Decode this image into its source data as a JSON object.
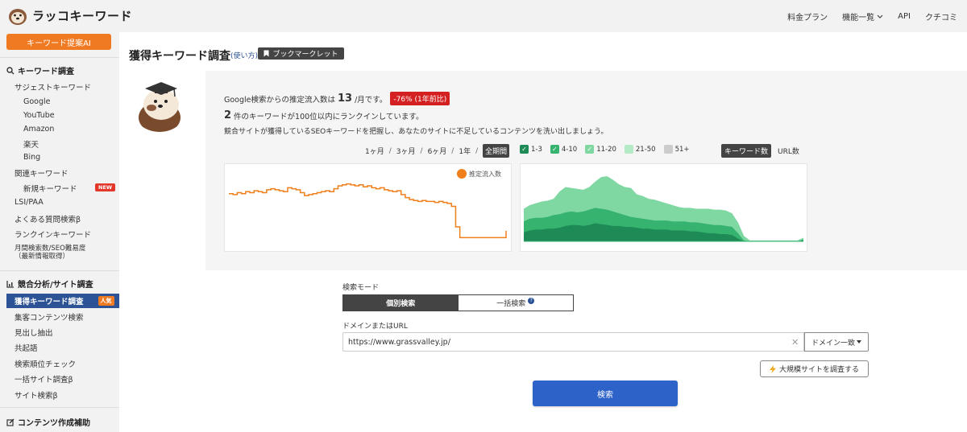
{
  "header": {
    "logo_text": "ラッコキーワード",
    "nav": [
      {
        "label": "料金プラン"
      },
      {
        "label": "機能一覧"
      },
      {
        "label": "API"
      },
      {
        "label": "クチコミ"
      }
    ]
  },
  "sidebar": {
    "ai_button": "キーワード提案AI",
    "section_keyword": "キーワード調査",
    "suggest": "サジェストキーワード",
    "sub_items": [
      "Google",
      "YouTube",
      "Amazon",
      "楽天",
      "Bing"
    ],
    "related": "関連キーワード",
    "new_keywords": "新規キーワード",
    "new_badge": "NEW",
    "lsi": "LSI/PAA",
    "faq": "よくある質問検索β",
    "rankin": "ランクインキーワード",
    "monthly_line1": "月間検索数/SEO難易度",
    "monthly_line2": "（最新情報取得）",
    "section_competitor": "競合分析/サイト調査",
    "acquired": "獲得キーワード調査",
    "popular_badge": "人気",
    "customer": "集客コンテンツ検索",
    "headings": "見出し抽出",
    "cooccur": "共起語",
    "rank_check": "検索順位チェック",
    "bulk_site": "一括サイト調査β",
    "site_search": "サイト検索β",
    "section_content": "コンテンツ作成補助"
  },
  "main": {
    "title": "獲得キーワード調査",
    "howto": "(使い方)",
    "bookmarklet": "ブックマークレット",
    "summary_prefix": "Google検索からの推定流入数は",
    "traffic_value": "13",
    "summary_suffix": "/月です。",
    "change_badge": "-76% (1年前比)",
    "rank_count": "2",
    "rank_text": "件のキーワードが100位以内にランクインしています。",
    "description": "競合サイトが獲得しているSEOキーワードを把握し、あなたのサイトに不足しているコンテンツを洗い出しましょう。",
    "periods": [
      "1ヶ月",
      "3ヶ月",
      "6ヶ月",
      "1年",
      "全期間"
    ],
    "selected_period": "全期間",
    "rank_filters": [
      {
        "label": "1-3",
        "color": "#1e8a55",
        "checked": true
      },
      {
        "label": "4-10",
        "color": "#35b36f",
        "checked": true
      },
      {
        "label": "11-20",
        "color": "#7fd8a2",
        "checked": true
      },
      {
        "label": "21-50",
        "color": "#b4eac6",
        "checked": false
      },
      {
        "label": "51+",
        "color": "#cccccc",
        "checked": false
      }
    ],
    "view_keyword": "キーワード数",
    "view_url": "URL数",
    "legend_traffic": "推定流入数"
  },
  "form": {
    "mode_label": "検索モード",
    "mode_single": "個別検索",
    "mode_bulk": "一括検索",
    "url_label": "ドメインまたはURL",
    "url_value": "https://www.grassvalley.jp/",
    "match_select": "ドメイン一致",
    "large_site": "大規模サイトを調査する",
    "search": "検索"
  },
  "colors": {
    "accent_orange": "#f07a22",
    "nav_active": "#2d5397",
    "search_button": "#2d62c9",
    "traffic_line": "#ef7f1a"
  },
  "chart_data": [
    {
      "type": "line",
      "series": [
        {
          "name": "推定流入数",
          "values": [
            48,
            47,
            49,
            48,
            50,
            49,
            51,
            50,
            49,
            52,
            53,
            52,
            51,
            50,
            54,
            53,
            52,
            49,
            46,
            47,
            48,
            49,
            50,
            51,
            50,
            53,
            56,
            57,
            58,
            57,
            56,
            57,
            55,
            56,
            54,
            53,
            54,
            52,
            51,
            50,
            51,
            47,
            44,
            42,
            41,
            40,
            41,
            40,
            40,
            39,
            40,
            39,
            38,
            35,
            14,
            3,
            3,
            3,
            3,
            3,
            3,
            3,
            3,
            3,
            3,
            3,
            10
          ]
        }
      ]
    },
    {
      "type": "area",
      "series": [
        {
          "name": "1-3",
          "values": [
            10,
            12,
            13,
            13,
            14,
            14,
            15,
            17,
            18,
            18,
            17,
            18,
            20,
            19,
            18,
            17,
            17,
            16,
            16,
            15,
            14,
            14,
            13,
            13,
            13,
            12,
            12,
            12,
            11,
            11,
            10,
            9,
            9,
            8,
            8,
            7,
            3,
            0,
            0,
            0,
            0,
            0,
            0,
            0,
            0,
            0,
            0,
            1
          ]
        },
        {
          "name": "4-10",
          "values": [
            22,
            25,
            26,
            26,
            27,
            29,
            30,
            32,
            33,
            32,
            33,
            35,
            37,
            36,
            35,
            33,
            31,
            29,
            27,
            26,
            25,
            24,
            23,
            23,
            23,
            22,
            22,
            22,
            21,
            21,
            20,
            19,
            18,
            18,
            17,
            16,
            9,
            1,
            0,
            0,
            0,
            0,
            0,
            0,
            0,
            0,
            0,
            2
          ]
        },
        {
          "name": "11-20",
          "values": [
            36,
            40,
            42,
            44,
            45,
            47,
            55,
            60,
            59,
            58,
            57,
            60,
            66,
            71,
            72,
            68,
            63,
            60,
            59,
            52,
            50,
            47,
            46,
            44,
            42,
            40,
            38,
            37,
            37,
            36,
            36,
            36,
            35,
            35,
            34,
            31,
            21,
            6,
            1,
            1,
            1,
            1,
            1,
            1,
            1,
            1,
            1,
            4
          ]
        }
      ]
    }
  ]
}
